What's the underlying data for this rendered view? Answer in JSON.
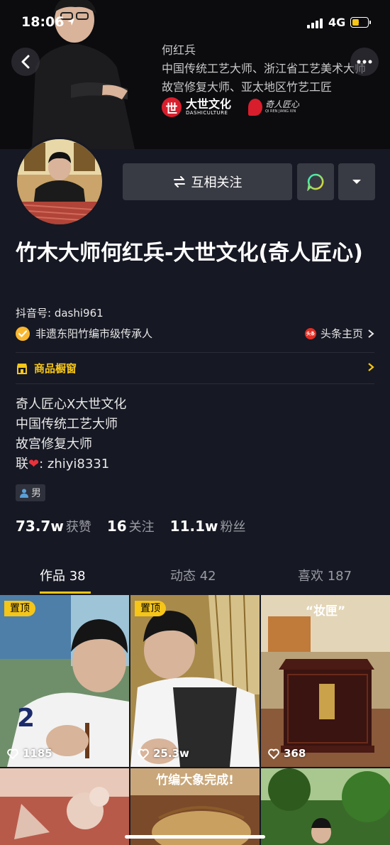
{
  "status_bar": {
    "time": "18:06",
    "network": "4G"
  },
  "banner": {
    "lines": [
      "何红兵",
      "中国传统工艺大师、浙江省工艺美术大师",
      "故宫修复大师、亚太地区竹艺工匠"
    ],
    "logo1_cn": "大世文化",
    "logo1_en": "DASHICULTURE",
    "logo1_mark": "世",
    "logo2_cn": "奇人匠心",
    "logo2_en": "QI REN JIANG XIN"
  },
  "actions": {
    "follow_label": "互相关注"
  },
  "profile": {
    "name": "竹木大师何红兵-大世文化(奇人匠心)",
    "douyin_id": "抖音号: dashi961",
    "verify_text": "非遗东阳竹编市级传承人",
    "toutiao_badge": "头条",
    "toutiao_label": "头条主页",
    "shop_label": "商品橱窗",
    "bio": [
      "奇人匠心X大世文化",
      "中国传统工艺大师",
      "故宫修复大师"
    ],
    "bio_contact_prefix": "联",
    "bio_contact_suffix": ": zhiyi8331",
    "gender": "男"
  },
  "stats": [
    {
      "num": "73.7w",
      "label": "获赞"
    },
    {
      "num": "16",
      "label": "关注"
    },
    {
      "num": "11.1w",
      "label": "粉丝"
    }
  ],
  "tabs": [
    {
      "label": "作品 38"
    },
    {
      "label": "动态 42"
    },
    {
      "label": "喜欢 187"
    }
  ],
  "videos": [
    {
      "pin": "置顶",
      "likes": "1185"
    },
    {
      "pin": "置顶",
      "likes": "25.3w"
    },
    {
      "title": "“妆匣”",
      "likes": "368"
    },
    {
      "likes": ""
    },
    {
      "title": "竹编大象完成!",
      "likes": ""
    },
    {
      "likes": ""
    }
  ],
  "colors": {
    "accent": "#f5c518",
    "bg": "#161823",
    "button": "#393b44"
  }
}
